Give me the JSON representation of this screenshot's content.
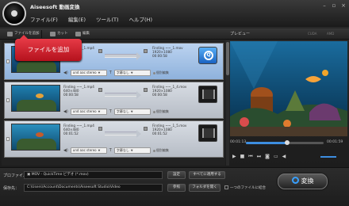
{
  "app": {
    "title": "Aiseesoft 動画変換"
  },
  "menu": [
    "ファイル(F)",
    "編集(E)",
    "ツール(T)",
    "ヘルプ(H)"
  ],
  "toolbar": {
    "add_file": "ファイルを追加",
    "cut": "カット",
    "edit": "編集",
    "cuda": "CUDA",
    "amd": "AMD"
  },
  "preview": {
    "title": "プレビュー",
    "time_current": "00:01:13",
    "time_total": "00:01:59",
    "progress": 0.53
  },
  "tooltip": "ファイルを追加",
  "files": [
    {
      "in_name": "Finding ~~_1.mp4",
      "in_res": "640×480",
      "in_dur": "00:00:58",
      "out_name": "Finding ~~_1.mov",
      "out_res": "1920×1080",
      "out_dur": "00:00:58",
      "audio": "und aac stereo",
      "subtitle": "字幕なし",
      "edit": "個別編集",
      "format": "qt",
      "selected": true
    },
    {
      "in_name": "Finding ~~_1.mp4",
      "in_res": "640×480",
      "in_dur": "00:00:58",
      "out_name": "Finding ~~_1_4.mov",
      "out_res": "1920×1080",
      "out_dur": "00:00:58",
      "audio": "und aac stereo",
      "subtitle": "字幕なし",
      "edit": "個別編集",
      "format": "film",
      "selected": false
    },
    {
      "in_name": "Finding ~~_1.mp4",
      "in_res": "640×480",
      "in_dur": "00:01:52",
      "out_name": "Finding ~~_1_5.mov",
      "out_res": "1920×1080",
      "out_dur": "00:01:52",
      "audio": "und aac stereo",
      "subtitle": "字幕なし",
      "edit": "個別編集",
      "format": "film",
      "selected": false
    }
  ],
  "bottom": {
    "profile_label": "プロファイル：",
    "profile_value": "MOV - QuickTime ビデオ (*.mov)",
    "settings": "設定",
    "apply_all": "すべてに適用する",
    "dest_label": "保存先：",
    "dest_value": "C:\\Users\\Account\\Documents\\Aiseesoft Studio\\Video",
    "browse": "参照",
    "open_folder": "フォルダを開く",
    "merge": "一つのファイルに結合",
    "convert": "変換"
  }
}
